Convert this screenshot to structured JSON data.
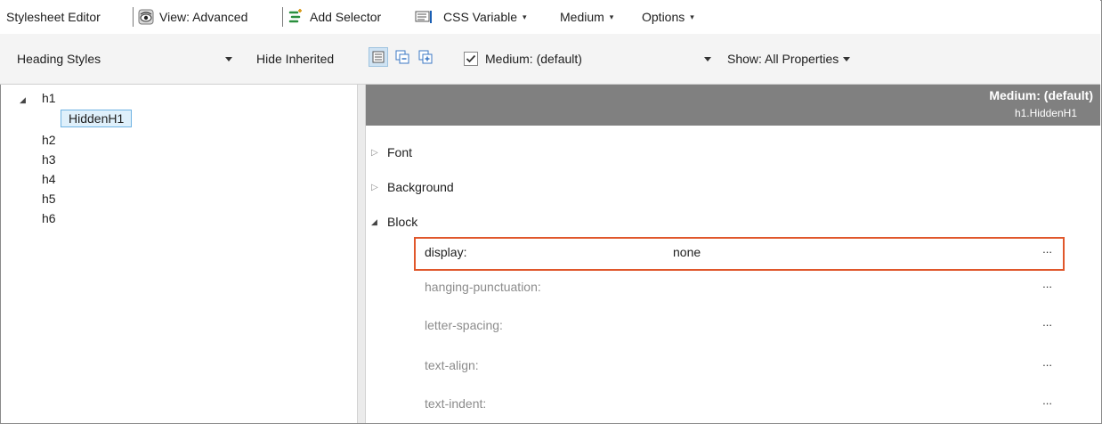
{
  "toolbar1": {
    "title": "Stylesheet Editor",
    "view_label": "View: Advanced",
    "add_selector_label": "Add Selector",
    "css_variable_label": "CSS Variable",
    "medium_label": "Medium",
    "options_label": "Options"
  },
  "toolbar2": {
    "stylesheet_select": "Heading Styles",
    "hide_inherited_label": "Hide Inherited",
    "medium_checkbox_label": "Medium: (default)",
    "medium_checked": true,
    "show_label": "Show: All Properties"
  },
  "tree": {
    "root": "h1",
    "selected_child": "HiddenH1",
    "items": [
      "h2",
      "h3",
      "h4",
      "h5",
      "h6"
    ]
  },
  "header": {
    "title": "Medium: (default)",
    "subtitle": "h1.HiddenH1"
  },
  "groups": {
    "font": "Font",
    "background": "Background",
    "block": "Block"
  },
  "properties": [
    {
      "name": "display:",
      "value": "none",
      "more": "...",
      "set": true
    },
    {
      "name": "hanging-punctuation:",
      "value": "",
      "more": "...",
      "set": false
    },
    {
      "name": "letter-spacing:",
      "value": "",
      "more": "...",
      "set": false
    },
    {
      "name": "text-align:",
      "value": "",
      "more": "...",
      "set": false
    },
    {
      "name": "text-indent:",
      "value": "",
      "more": "...",
      "set": false
    }
  ],
  "colors": {
    "highlight": "#e0572b",
    "header_bg": "#808080",
    "selection_bg": "#dff0fb"
  }
}
